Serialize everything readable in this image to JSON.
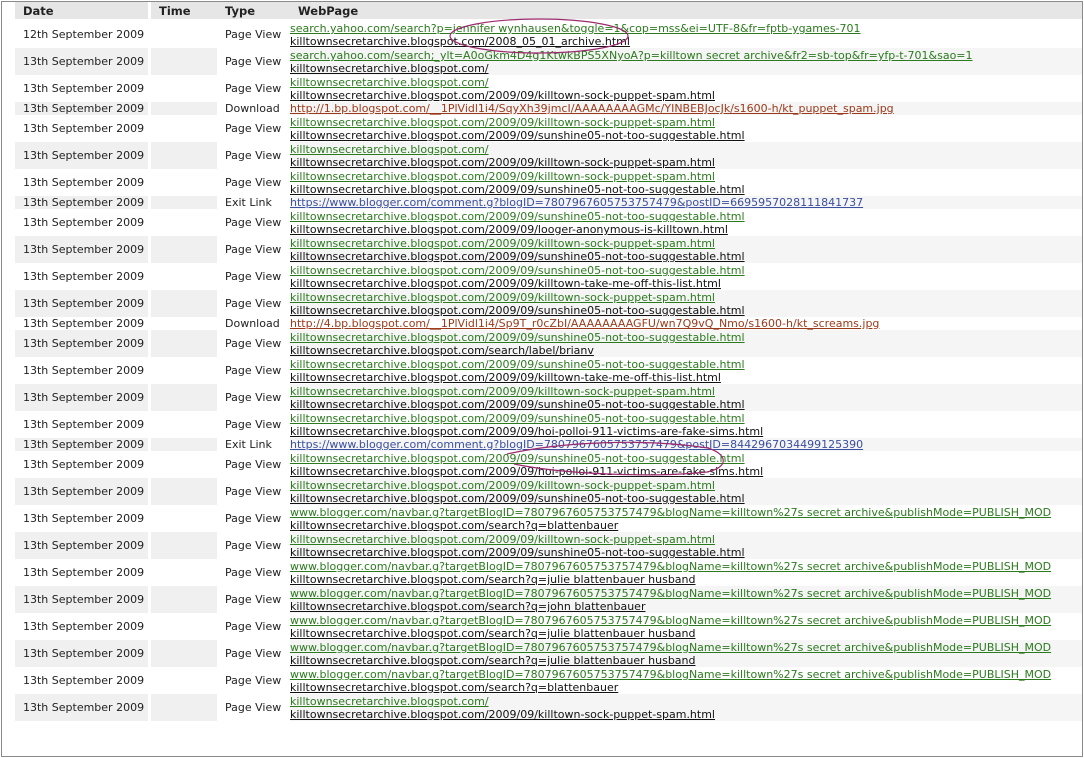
{
  "columns": [
    "Date",
    "Time",
    "Type",
    "WebPage"
  ],
  "rows": [
    {
      "date": "12th September 2009",
      "time": "",
      "type": "Page View",
      "links": [
        {
          "text": "search.yahoo.com/search?p=jennifer wynhausen&toggle=1&cop=mss&ei=UTF-8&fr=fptb-ygames-701",
          "color": "green"
        },
        {
          "text": "killtownsecretarchive.blogspot.com/2008_05_01_archive.html",
          "color": "black"
        }
      ]
    },
    {
      "date": "13th September 2009",
      "time": "",
      "type": "Page View",
      "links": [
        {
          "text": "search.yahoo.com/search;_ylt=A0oGkm4D4g1KtwkBPS5XNyoA?p=killtown secret archive&fr2=sb-top&fr=yfp-t-701&sao=1",
          "color": "green"
        },
        {
          "text": "killtownsecretarchive.blogspot.com/",
          "color": "black"
        }
      ]
    },
    {
      "date": "13th September 2009",
      "time": "",
      "type": "Page View",
      "links": [
        {
          "text": "killtownsecretarchive.blogspot.com/",
          "color": "green"
        },
        {
          "text": "killtownsecretarchive.blogspot.com/2009/09/killtown-sock-puppet-spam.html",
          "color": "black"
        }
      ]
    },
    {
      "date": "13th September 2009",
      "time": "",
      "type": "Download",
      "links": [
        {
          "text": "http://1.bp.blogspot.com/__1PlVidl1i4/SqyXh39jmcI/AAAAAAAAGMc/YINBEBJocJk/s1600-h/kt_puppet_spam.jpg",
          "color": "red"
        }
      ]
    },
    {
      "date": "13th September 2009",
      "time": "",
      "type": "Page View",
      "links": [
        {
          "text": "killtownsecretarchive.blogspot.com/2009/09/killtown-sock-puppet-spam.html",
          "color": "green"
        },
        {
          "text": "killtownsecretarchive.blogspot.com/2009/09/sunshine05-not-too-suggestable.html",
          "color": "black"
        }
      ]
    },
    {
      "date": "13th September 2009",
      "time": "",
      "type": "Page View",
      "links": [
        {
          "text": "killtownsecretarchive.blogspot.com/",
          "color": "green"
        },
        {
          "text": "killtownsecretarchive.blogspot.com/2009/09/killtown-sock-puppet-spam.html",
          "color": "black"
        }
      ]
    },
    {
      "date": "13th September 2009",
      "time": "",
      "type": "Page View",
      "links": [
        {
          "text": "killtownsecretarchive.blogspot.com/2009/09/killtown-sock-puppet-spam.html",
          "color": "green"
        },
        {
          "text": "killtownsecretarchive.blogspot.com/2009/09/sunshine05-not-too-suggestable.html",
          "color": "black"
        }
      ]
    },
    {
      "date": "13th September 2009",
      "time": "",
      "type": "Exit Link",
      "links": [
        {
          "text": "https://www.blogger.com/comment.g?blogID=7807967605753757479&postID=6695957028111841737",
          "color": "blue"
        }
      ]
    },
    {
      "date": "13th September 2009",
      "time": "",
      "type": "Page View",
      "links": [
        {
          "text": "killtownsecretarchive.blogspot.com/2009/09/sunshine05-not-too-suggestable.html",
          "color": "green"
        },
        {
          "text": "killtownsecretarchive.blogspot.com/2009/09/looger-anonymous-is-killtown.html",
          "color": "black"
        }
      ]
    },
    {
      "date": "13th September 2009",
      "time": "",
      "type": "Page View",
      "links": [
        {
          "text": "killtownsecretarchive.blogspot.com/2009/09/killtown-sock-puppet-spam.html",
          "color": "green"
        },
        {
          "text": "killtownsecretarchive.blogspot.com/2009/09/sunshine05-not-too-suggestable.html",
          "color": "black"
        }
      ]
    },
    {
      "date": "13th September 2009",
      "time": "",
      "type": "Page View",
      "links": [
        {
          "text": "killtownsecretarchive.blogspot.com/2009/09/sunshine05-not-too-suggestable.html",
          "color": "green"
        },
        {
          "text": "killtownsecretarchive.blogspot.com/2009/09/killtown-take-me-off-this-list.html",
          "color": "black"
        }
      ]
    },
    {
      "date": "13th September 2009",
      "time": "",
      "type": "Page View",
      "links": [
        {
          "text": "killtownsecretarchive.blogspot.com/2009/09/killtown-sock-puppet-spam.html",
          "color": "green"
        },
        {
          "text": "killtownsecretarchive.blogspot.com/2009/09/sunshine05-not-too-suggestable.html",
          "color": "black"
        }
      ]
    },
    {
      "date": "13th September 2009",
      "time": "",
      "type": "Download",
      "links": [
        {
          "text": "http://4.bp.blogspot.com/__1PlVidl1i4/Sp9T_r0cZbI/AAAAAAAAGFU/wn7Q9vQ_Nmo/s1600-h/kt_screams.jpg",
          "color": "red"
        }
      ]
    },
    {
      "date": "13th September 2009",
      "time": "",
      "type": "Page View",
      "links": [
        {
          "text": "killtownsecretarchive.blogspot.com/2009/09/sunshine05-not-too-suggestable.html",
          "color": "green"
        },
        {
          "text": "killtownsecretarchive.blogspot.com/search/label/brianv",
          "color": "black"
        }
      ]
    },
    {
      "date": "13th September 2009",
      "time": "",
      "type": "Page View",
      "links": [
        {
          "text": "killtownsecretarchive.blogspot.com/2009/09/sunshine05-not-too-suggestable.html",
          "color": "green"
        },
        {
          "text": "killtownsecretarchive.blogspot.com/2009/09/killtown-take-me-off-this-list.html",
          "color": "black"
        }
      ]
    },
    {
      "date": "13th September 2009",
      "time": "",
      "type": "Page View",
      "links": [
        {
          "text": "killtownsecretarchive.blogspot.com/2009/09/killtown-sock-puppet-spam.html",
          "color": "green"
        },
        {
          "text": "killtownsecretarchive.blogspot.com/2009/09/sunshine05-not-too-suggestable.html",
          "color": "black"
        }
      ]
    },
    {
      "date": "13th September 2009",
      "time": "",
      "type": "Page View",
      "links": [
        {
          "text": "killtownsecretarchive.blogspot.com/2009/09/sunshine05-not-too-suggestable.html",
          "color": "green"
        },
        {
          "text": "killtownsecretarchive.blogspot.com/2009/09/hoi-polloi-911-victims-are-fake-sims.html",
          "color": "black"
        }
      ]
    },
    {
      "date": "13th September 2009",
      "time": "",
      "type": "Exit Link",
      "links": [
        {
          "text": "https://www.blogger.com/comment.g?blogID=7807967605753757479&postID=8442967034499125390",
          "color": "blue"
        }
      ]
    },
    {
      "date": "13th September 2009",
      "time": "",
      "type": "Page View",
      "links": [
        {
          "text": "killtownsecretarchive.blogspot.com/2009/09/sunshine05-not-too-suggestable.html",
          "color": "green"
        },
        {
          "text": "killtownsecretarchive.blogspot.com/2009/09/hoi-polloi-911-victims-are-fake-sims.html",
          "color": "black"
        }
      ]
    },
    {
      "date": "13th September 2009",
      "time": "",
      "type": "Page View",
      "links": [
        {
          "text": "killtownsecretarchive.blogspot.com/2009/09/killtown-sock-puppet-spam.html",
          "color": "green"
        },
        {
          "text": "killtownsecretarchive.blogspot.com/2009/09/sunshine05-not-too-suggestable.html",
          "color": "black"
        }
      ]
    },
    {
      "date": "13th September 2009",
      "time": "",
      "type": "Page View",
      "links": [
        {
          "text": "www.blogger.com/navbar.g?targetBlogID=7807967605753757479&blogName=killtown%27s secret archive&publishMode=PUBLISH_MOD",
          "color": "green"
        },
        {
          "text": "killtownsecretarchive.blogspot.com/search?q=blattenbauer",
          "color": "black"
        }
      ]
    },
    {
      "date": "13th September 2009",
      "time": "",
      "type": "Page View",
      "links": [
        {
          "text": "killtownsecretarchive.blogspot.com/2009/09/killtown-sock-puppet-spam.html",
          "color": "green"
        },
        {
          "text": "killtownsecretarchive.blogspot.com/2009/09/sunshine05-not-too-suggestable.html",
          "color": "black"
        }
      ]
    },
    {
      "date": "13th September 2009",
      "time": "",
      "type": "Page View",
      "links": [
        {
          "text": "www.blogger.com/navbar.g?targetBlogID=7807967605753757479&blogName=killtown%27s secret archive&publishMode=PUBLISH_MOD",
          "color": "green"
        },
        {
          "text": "killtownsecretarchive.blogspot.com/search?q=julie blattenbauer husband",
          "color": "black"
        }
      ]
    },
    {
      "date": "13th September 2009",
      "time": "",
      "type": "Page View",
      "links": [
        {
          "text": "www.blogger.com/navbar.g?targetBlogID=7807967605753757479&blogName=killtown%27s secret archive&publishMode=PUBLISH_MOD",
          "color": "green"
        },
        {
          "text": "killtownsecretarchive.blogspot.com/search?q=john blattenbauer",
          "color": "black"
        }
      ]
    },
    {
      "date": "13th September 2009",
      "time": "",
      "type": "Page View",
      "links": [
        {
          "text": "www.blogger.com/navbar.g?targetBlogID=7807967605753757479&blogName=killtown%27s secret archive&publishMode=PUBLISH_MOD",
          "color": "green"
        },
        {
          "text": "killtownsecretarchive.blogspot.com/search?q=julie blattenbauer husband",
          "color": "black"
        }
      ]
    },
    {
      "date": "13th September 2009",
      "time": "",
      "type": "Page View",
      "links": [
        {
          "text": "www.blogger.com/navbar.g?targetBlogID=7807967605753757479&blogName=killtown%27s secret archive&publishMode=PUBLISH_MOD",
          "color": "green"
        },
        {
          "text": "killtownsecretarchive.blogspot.com/search?q=julie blattenbauer husband",
          "color": "black"
        }
      ]
    },
    {
      "date": "13th September 2009",
      "time": "",
      "type": "Page View",
      "links": [
        {
          "text": "www.blogger.com/navbar.g?targetBlogID=7807967605753757479&blogName=killtown%27s secret archive&publishMode=PUBLISH_MOD",
          "color": "green"
        },
        {
          "text": "killtownsecretarchive.blogspot.com/search?q=blattenbauer",
          "color": "black"
        }
      ]
    },
    {
      "date": "13th September 2009",
      "time": "",
      "type": "Page View",
      "links": [
        {
          "text": "killtownsecretarchive.blogspot.com/",
          "color": "green"
        },
        {
          "text": "killtownsecretarchive.blogspot.com/2009/09/killtown-sock-puppet-spam.html",
          "color": "black"
        }
      ]
    }
  ],
  "annotation_color": "#9b2a6e"
}
